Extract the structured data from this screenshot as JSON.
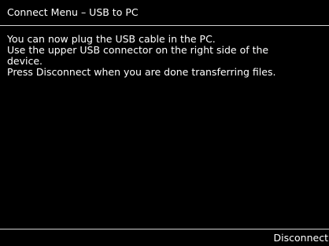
{
  "header": {
    "title": "Connect Menu – USB to PC"
  },
  "message": {
    "lines": [
      "You can now plug the USB cable in the PC.",
      "Use the upper USB connector on the right side of the",
      "device.",
      "Press Disconnect when you are done transferring files."
    ]
  },
  "softkeys": {
    "right_label": "Disconnect"
  },
  "colors": {
    "background": "#000000",
    "text": "#ffffff",
    "divider": "#d0d0d0"
  }
}
